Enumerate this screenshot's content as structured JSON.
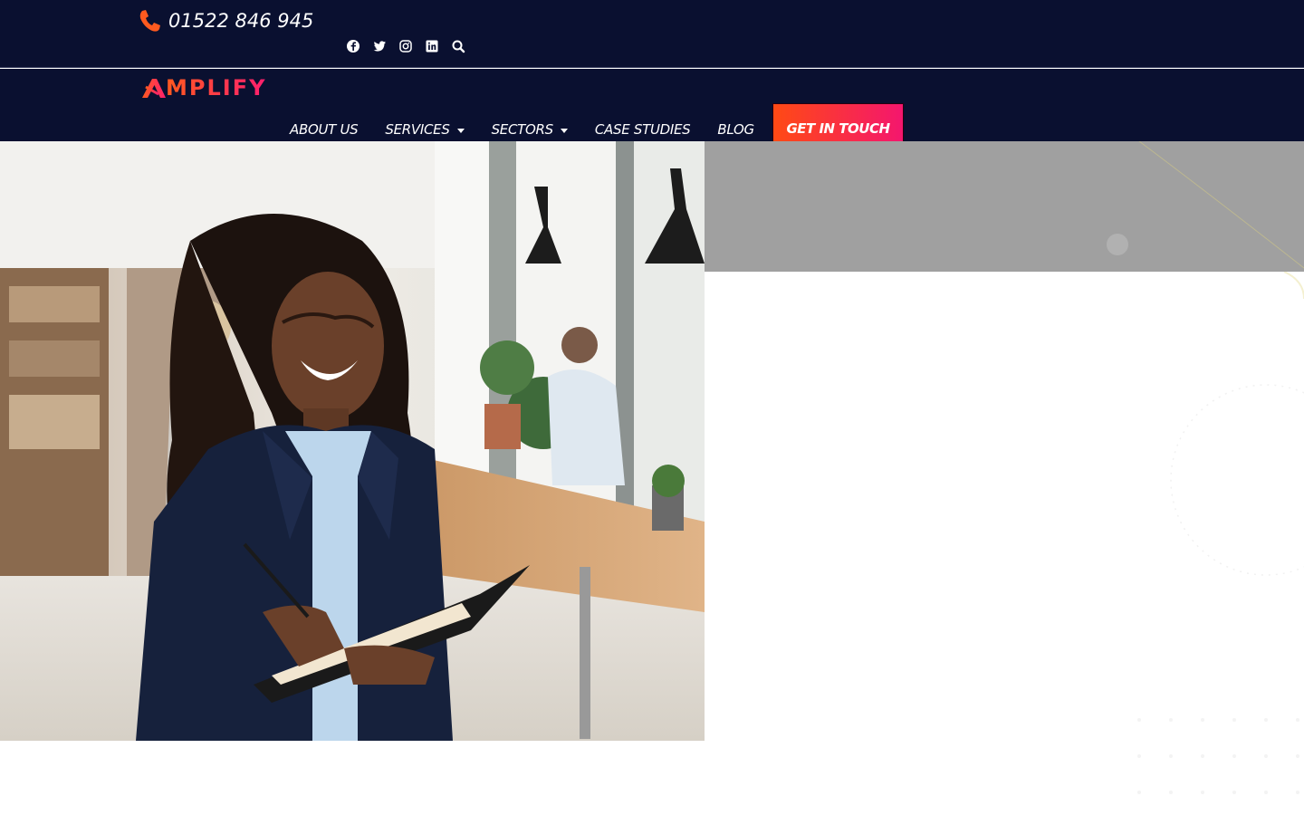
{
  "topbar": {
    "phone_number": "01522 846 945",
    "phone_icon": "phone-icon",
    "socials": [
      "facebook-icon",
      "twitter-icon",
      "instagram-icon",
      "linkedin-icon",
      "search-icon"
    ]
  },
  "header": {
    "logo_text": "MPLIFY",
    "nav": {
      "about": "ABOUT US",
      "services": "SERVICES",
      "sectors": "SECTORS",
      "case_studies": "CASE STUDIES",
      "blog": "BLOG",
      "cta": "GET IN TOUCH"
    }
  },
  "colors": {
    "navy": "#0a1030",
    "accent_orange": "#ff4a14",
    "accent_pink": "#f4166e",
    "grey_panel": "#a0a0a0"
  },
  "hero": {
    "image_subject": "businesswoman-writing-in-notebook"
  }
}
